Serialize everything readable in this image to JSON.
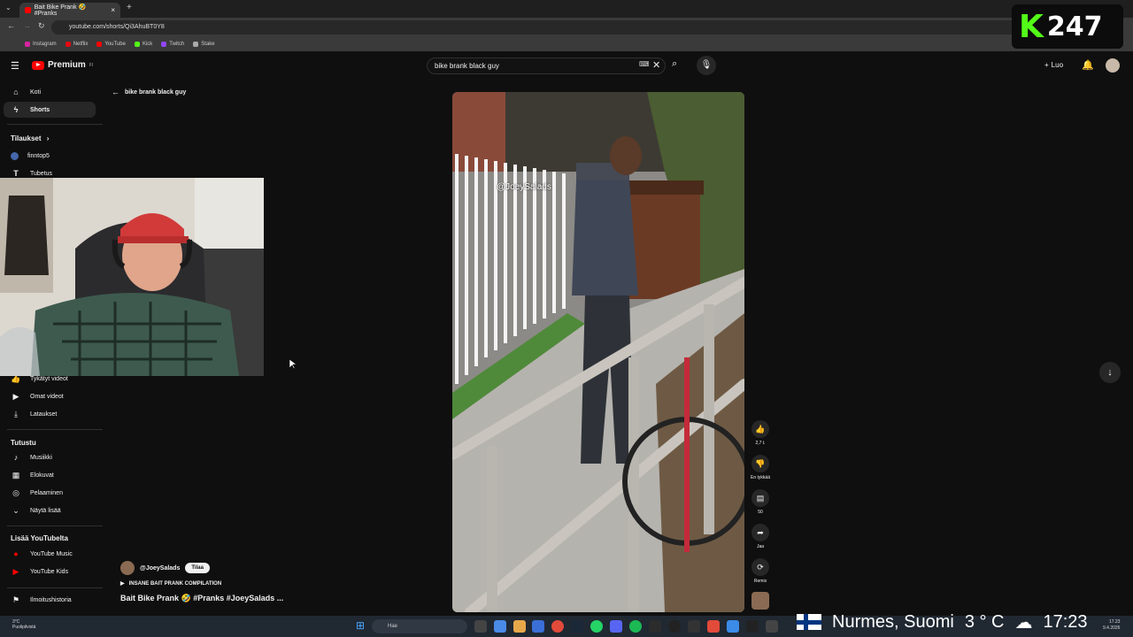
{
  "browser": {
    "tab_title": "Bait Bike Prank 🤣 #Pranks",
    "url": "youtube.com/shorts/Qi3AhuBT0Y8",
    "bookmarks": [
      "Instagram",
      "Netflix",
      "YouTube",
      "Kick",
      "Twitch",
      "Stake"
    ]
  },
  "youtube": {
    "logo_text": "Premium",
    "logo_sup": "FI",
    "search_value": "bike brank black guy",
    "create_label": "Luo"
  },
  "sidebar": {
    "home": "Koti",
    "shorts": "Shorts",
    "subscriptions_title": "Tilaukset",
    "subs": [
      "finntop5",
      "Tubetus"
    ],
    "you_items": [
      "Tykätyt videot",
      "Omat videot",
      "Lataukset"
    ],
    "explore_title": "Tutustu",
    "explore_items": [
      "Musiikki",
      "Elokuvat",
      "Pelaaminen",
      "Näytä lisää"
    ],
    "more_title": "Lisää YouTubelta",
    "more_items": [
      "YouTube Music",
      "YouTube Kids"
    ],
    "report": "Ilmoitushistoria"
  },
  "shorts": {
    "back_label": "bike brank black guy",
    "watermark": "@JoeySalads",
    "actions": [
      {
        "icon": "like-icon",
        "label": "2,7 t."
      },
      {
        "icon": "dislike-icon",
        "label": "En tykkää"
      },
      {
        "icon": "comment-icon",
        "label": "50"
      },
      {
        "icon": "share-icon",
        "label": "Jaa"
      },
      {
        "icon": "remix-icon",
        "label": "Remix"
      }
    ],
    "channel": "@JoeySalads",
    "subscribe": "Tilaa",
    "playlist": "INSANE BAIT PRANK COMPILATION",
    "title": "Bait Bike Prank 🤣 #Pranks #JoeySalads ..."
  },
  "overlay": {
    "k": "K",
    "num": "247",
    "location": "Nurmes, Suomi",
    "temperature": "3 ° C",
    "time": "17:23"
  },
  "taskbar": {
    "weather_temp": "3°C",
    "weather_desc": "Puolipilvistä",
    "search_placeholder": "Hae",
    "clock_time": "17.23",
    "clock_date": "9.4.2026"
  }
}
